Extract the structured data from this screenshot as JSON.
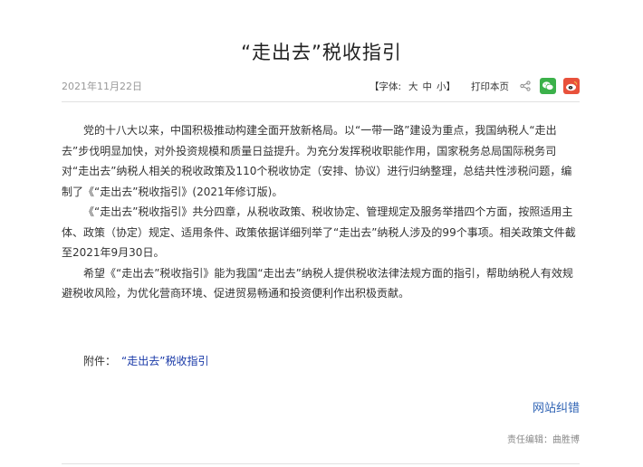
{
  "article": {
    "title": "“走出去”税收指引",
    "date": "2021年11月22日",
    "paragraphs": [
      "党的十八大以来，中国积极推动构建全面开放新格局。以“一带一路”建设为重点，我国纳税人“走出去”步伐明显加快，对外投资规模和质量日益提升。为充分发挥税收职能作用，国家税务总局国际税务司对“走出去”纳税人相关的税收政策及110个税收协定（安排、协议）进行归纳整理，总结共性涉税问题，编制了《“走出去”税收指引》(2021年修订版)。",
      "《“走出去”税收指引》共分四章，从税收政策、税收协定、管理规定及服务举措四个方面，按照适用主体、政策（协定）规定、适用条件、政策依据详细列举了“走出去”纳税人涉及的99个事项。相关政策文件截至2021年9月30日。",
      "希望《“走出去”税收指引》能为我国“走出去”纳税人提供税收法律法规方面的指引，帮助纳税人有效规避税收风险，为优化营商环境、促进贸易畅通和投资便利作出积极贡献。"
    ],
    "attachment_label": "附件：",
    "attachment_link": "“走出去”税收指引",
    "report_error": "网站纠错",
    "editor": "责任编辑：曲胜博"
  },
  "toolbar": {
    "font_label": "【字体:",
    "size_large": "大",
    "size_medium": "中",
    "size_small": "小】",
    "print": "打印本页",
    "icons": [
      "share-icon",
      "wechat-icon",
      "weibo-icon"
    ]
  },
  "colors": {
    "link": "#1a3aa8",
    "report": "#2f63b4",
    "wechat": "#3bb14a",
    "weibo": "#e8513b"
  }
}
